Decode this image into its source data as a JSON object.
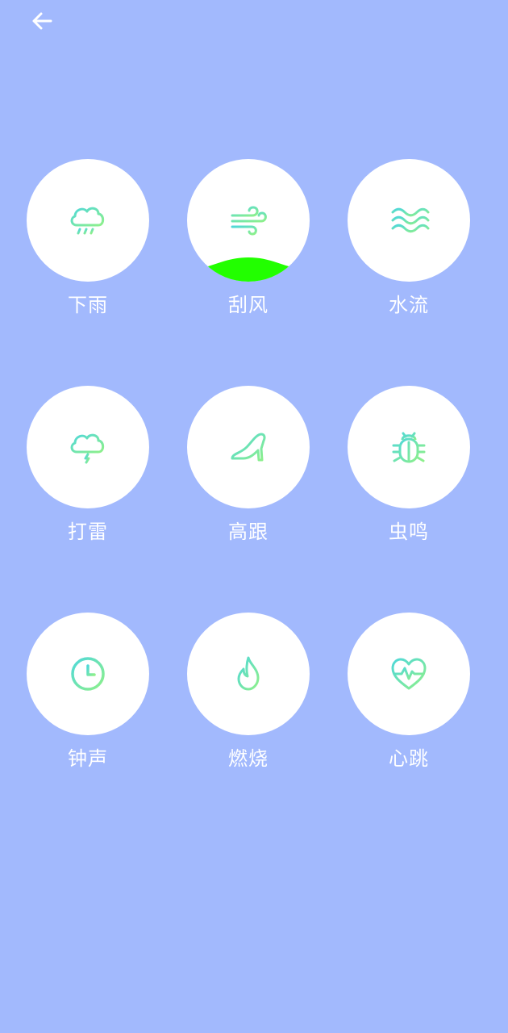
{
  "header": {
    "back_icon": "arrow-left-icon"
  },
  "colors": {
    "background": "#a2b9fd",
    "tile": "#ffffff",
    "label": "#ffffff",
    "icon_gradient_start": "#5fe0cf",
    "icon_gradient_end": "#8ef08a",
    "active_wave": "#22ff00"
  },
  "sounds": [
    {
      "id": "rain",
      "label": "下雨",
      "icon": "rain-cloud-icon",
      "active": false
    },
    {
      "id": "wind",
      "label": "刮风",
      "icon": "wind-icon",
      "active": true,
      "level": 0.14
    },
    {
      "id": "water",
      "label": "水流",
      "icon": "waves-icon",
      "active": false
    },
    {
      "id": "thunder",
      "label": "打雷",
      "icon": "thunder-cloud-icon",
      "active": false
    },
    {
      "id": "heels",
      "label": "高跟",
      "icon": "high-heel-icon",
      "active": false
    },
    {
      "id": "insects",
      "label": "虫鸣",
      "icon": "bug-icon",
      "active": false
    },
    {
      "id": "clock",
      "label": "钟声",
      "icon": "clock-icon",
      "active": false
    },
    {
      "id": "fire",
      "label": "燃烧",
      "icon": "flame-icon",
      "active": false
    },
    {
      "id": "heartbeat",
      "label": "心跳",
      "icon": "heartbeat-icon",
      "active": false
    }
  ]
}
